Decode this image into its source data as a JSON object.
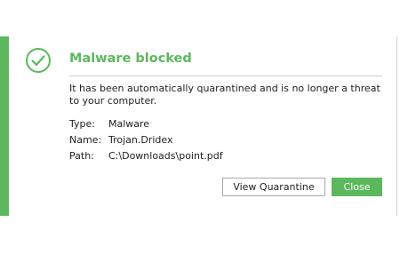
{
  "dialog": {
    "title": "Malware blocked",
    "message": "It has been automatically quarantined and is no longer a threat to your computer.",
    "icon": "checkmark-circle-icon",
    "details": {
      "type_label": "Type:",
      "type_value": "Malware",
      "name_label": "Name:",
      "name_value": "Trojan.Dridex",
      "path_label": "Path:",
      "path_value": "C:\\Downloads\\point.pdf"
    },
    "buttons": {
      "view_quarantine": "View Quarantine",
      "close": "Close"
    }
  },
  "colors": {
    "accent": "#5cb85c",
    "text": "#222222",
    "divider": "#cfcfcf"
  }
}
